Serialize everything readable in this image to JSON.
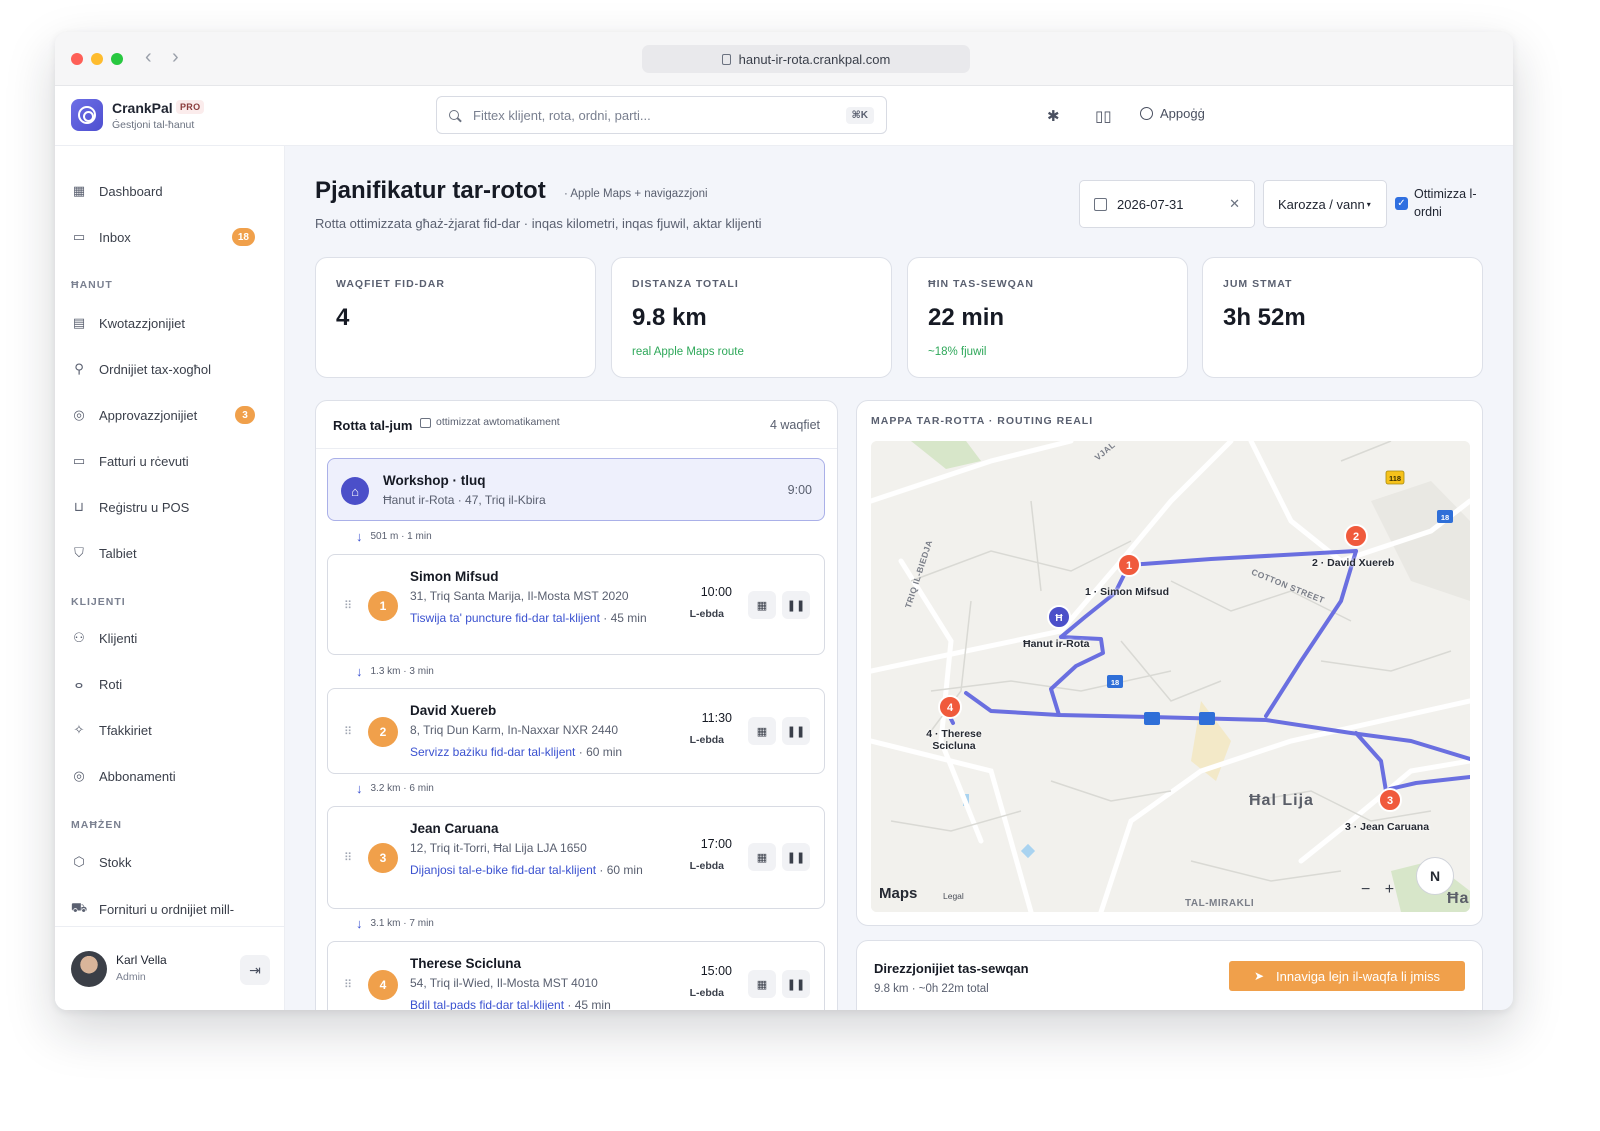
{
  "browser": {
    "url": "hanut-ir-rota.crankpal.com"
  },
  "brand": {
    "name": "CrankPal",
    "badge": "PRO",
    "subtitle": "Ġestjoni tal-ħanut"
  },
  "header": {
    "search_placeholder": "Fittex klijent, rota, ordni, parti...",
    "search_shortcut": "⌘K",
    "help_label": "Appoġġ",
    "icons": [
      "bug-icon",
      "book-icon",
      "lifebuoy-icon"
    ]
  },
  "sidebar": {
    "main_items": [
      {
        "label": "Dashboard",
        "icon": "grid-icon"
      },
      {
        "label": "Inbox",
        "icon": "inbox-icon",
        "badge": "18"
      }
    ],
    "sections": [
      {
        "title": "ĦANUT",
        "items": [
          {
            "label": "Kwotazzjonijiet",
            "icon": "document-icon"
          },
          {
            "label": "Ordnijiet tax-xogħol",
            "icon": "wrench-icon"
          },
          {
            "label": "Approvazzjonijiet",
            "icon": "check-circle-icon",
            "badge": "3"
          },
          {
            "label": "Fatturi u rċevuti",
            "icon": "cash-icon"
          },
          {
            "label": "Reġistru u POS",
            "icon": "cart-icon"
          },
          {
            "label": "Talbiet",
            "icon": "shield-icon"
          }
        ]
      },
      {
        "title": "KLIJENTI",
        "items": [
          {
            "label": "Klijenti",
            "icon": "users-icon"
          },
          {
            "label": "Roti",
            "icon": "bike-icon"
          },
          {
            "label": "Tfakkiriet",
            "icon": "sparkle-icon"
          },
          {
            "label": "Abbonamenti",
            "icon": "check-circle-icon"
          }
        ]
      },
      {
        "title": "MAĦŻEN",
        "items": [
          {
            "label": "Stokk",
            "icon": "box-icon"
          },
          {
            "label": "Fornituri u ordnijiet mill-",
            "icon": "truck-icon"
          }
        ]
      }
    ],
    "user": {
      "name": "Karl Vella",
      "role": "Admin"
    }
  },
  "page": {
    "title": "Pjanifikatur tar-rotot",
    "title_note": "· Apple Maps + navigazzjoni",
    "description": "Rotta ottimizzata għaż-żjarat fid-dar · inqas kilometri, inqas fjuwil, aktar klijenti",
    "date": "2026-07-31",
    "vehicle": "Karozza / vann",
    "optimize_label": "Ottimizza l-ordni",
    "optimize_checked": true
  },
  "stats": [
    {
      "label": "WAQFIET FID-DAR",
      "value": "4",
      "note": ""
    },
    {
      "label": "DISTANZA TOTALI",
      "value": "9.8 km",
      "note": "real Apple Maps route"
    },
    {
      "label": "ĦIN TAS-SEWQAN",
      "value": "22 min",
      "note": "~18% fjuwil"
    },
    {
      "label": "JUM STMAT",
      "value": "3h 52m",
      "note": ""
    }
  ],
  "route": {
    "title": "Rotta tal-jum",
    "subtitle": "ottimizzat awtomatikament",
    "count": "4 waqfiet",
    "depot": {
      "name": "Workshop · tluq",
      "address": "Ħanut ir-Rota · 47, Triq il-Kbira",
      "time": "9:00"
    },
    "legs": [
      "501 m · 1 min",
      "1.3 km · 3 min",
      "3.2 km · 6 min",
      "3.1 km · 7 min"
    ],
    "stops": [
      {
        "num": "1",
        "name": "Simon Mifsud",
        "address": "31, Triq Santa Marija, Il-Mosta MST 2020",
        "service": "Tiswija ta' puncture fid-dar tal-klijent",
        "duration": "· 45 min",
        "time": "10:00",
        "day": "L-ebda"
      },
      {
        "num": "2",
        "name": "David Xuereb",
        "address": "8, Triq Dun Karm, In-Naxxar NXR 2440",
        "service": "Servizz bażiku fid-dar tal-klijent",
        "duration": "· 60 min",
        "time": "11:30",
        "day": "L-ebda"
      },
      {
        "num": "3",
        "name": "Jean Caruana",
        "address": "12, Triq it-Torri, Ħal Lija LJA 1650",
        "service": "Dijanjosi tal-e-bike fid-dar tal-klijent",
        "duration": "· 60 min",
        "time": "17:00",
        "day": "L-ebda"
      },
      {
        "num": "4",
        "name": "Therese Scicluna",
        "address": "54, Triq il-Wied, Il-Mosta MST 4010",
        "service": "Bdil tal-pads fid-dar tal-klijent",
        "duration": "· 45 min",
        "time": "15:00",
        "day": "L-ebda"
      }
    ]
  },
  "map": {
    "label": "MAPPA TAR-ROTTA · ROUTING REALI",
    "pins": [
      {
        "num": "1",
        "label": "1 · Simon Mifsud"
      },
      {
        "num": "2",
        "label": "2 · David Xuereb"
      },
      {
        "num": "3",
        "label": "3 · Jean Caruana"
      },
      {
        "num": "4",
        "label": "4 · Therese Scicluna"
      }
    ],
    "depot_label": "Ħanut ir-Rota",
    "town": "Ħal Lija",
    "area": "TAL-MIRAKLI",
    "partial_text": "Ħa",
    "streets": [
      "COTTON STREET",
      "TRIQ IL-BIEDJA",
      "VJAL"
    ],
    "road_shields": [
      "118",
      "18",
      "18"
    ],
    "brand": "Maps",
    "legal": "Legal",
    "compass": "N",
    "route_color": "#6a6fe0",
    "pin_color": "#f05a3c"
  },
  "directions": {
    "title": "Direzzjonijiet tas-sewqan",
    "summary": "9.8 km · ~0h 22m total",
    "button": "Innaviga lejn il-waqfa li jmiss"
  }
}
